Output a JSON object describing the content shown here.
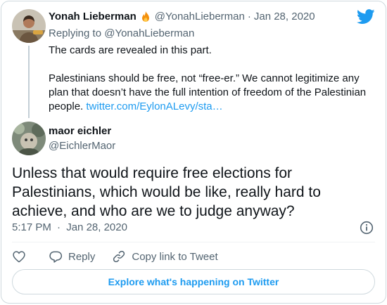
{
  "parent_tweet": {
    "author_name": "Yonah Lieberman",
    "author_handle": "@YonahLieberman",
    "separator": "·",
    "date": "Jan 28, 2020",
    "replying_to": "Replying to @YonahLieberman",
    "paragraph1": "The cards are revealed in this part.",
    "paragraph2": "Palestinians should be free, not “free-er.” We cannot legitimize any plan that doesn’t have the full intention of freedom of the Palestinian people.",
    "link": "twitter.com/EylonALevy/sta…"
  },
  "tweet": {
    "author_name": "maor eichler",
    "author_handle": "@EichlerMaor",
    "text": "Unless that would require free elections for Palestinians, which would be like, really hard to achieve, and who are we to judge anyway?",
    "time": "5:17 PM",
    "separator": "·",
    "date": "Jan 28, 2020"
  },
  "actions": {
    "reply_label": "Reply",
    "copy_link_label": "Copy link to Tweet"
  },
  "explore_label": "Explore what's happening on Twitter",
  "colors": {
    "brand_blue": "#1d9bf0",
    "text": "#0f1419",
    "muted": "#536471",
    "border": "#cfd9de"
  },
  "icons": [
    "twitter-bird-icon",
    "fire-emoji-icon",
    "info-icon",
    "heart-icon",
    "reply-icon",
    "link-icon"
  ]
}
